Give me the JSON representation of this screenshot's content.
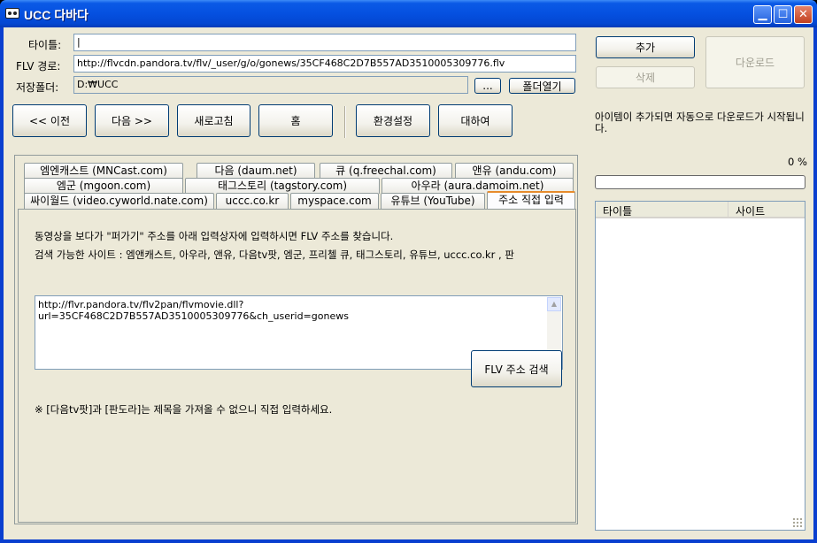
{
  "window": {
    "title": "UCC 다바다"
  },
  "form": {
    "title_label": "타이틀:",
    "title_value": "|",
    "flv_label": "FLV 경로:",
    "flv_value": "http://flvcdn.pandora.tv/flv/_user/g/o/gonews/35CF468C2D7B557AD3510005309776.flv",
    "folder_label": "저장폴더:",
    "folder_value": "D:₩UCC",
    "browse_label": "...",
    "open_folder_label": "폴더열기"
  },
  "actions": {
    "add": "추가",
    "delete": "삭제",
    "download": "다운로드"
  },
  "nav": {
    "prev": "<< 이전",
    "next": "다음 >>",
    "refresh": "새로고침",
    "home": "홈",
    "settings": "환경설정",
    "about": "대하여"
  },
  "notice": "아이템이 추가되면 자동으로 다운로드가 시작됩니다.",
  "progress": {
    "percent_text": "0 %",
    "value": 0
  },
  "list": {
    "col_title": "타이틀",
    "col_site": "사이트"
  },
  "tabs": {
    "row1": [
      "엠엔캐스트 (MNCast.com)",
      "다음 (daum.net)",
      "큐 (q.freechal.com)",
      "앤유 (andu.com)"
    ],
    "row2": [
      "엠군 (mgoon.com)",
      "태그스토리 (tagstory.com)",
      "아우라 (aura.damoim.net)"
    ],
    "row3": [
      "싸이월드 (video.cyworld.nate.com)",
      "uccc.co.kr",
      "myspace.com",
      "유튜브 (YouTube)",
      "주소 직접 입력"
    ]
  },
  "content": {
    "line1": "동영상을 보다가 \"퍼가기\" 주소를 아래 입력상자에 입력하시면 FLV 주소를 찾습니다.",
    "line2": "검색 가능한 사이트 : 엠앤캐스트, 아우라, 앤유, 다음tv팟, 엠군, 프리첼 큐, 태그스토리, 유튜브, uccc.co.kr , 판",
    "url_input": "http://flvr.pandora.tv/flv2pan/flvmovie.dll?url=35CF468C2D7B557AD3510005309776&ch_userid=gonews",
    "search_button": "FLV 주소 검색",
    "warning": "※ [다음tv팟]과 [판도라]는 제목을 가져올 수 없으니 직접 입력하세요."
  }
}
